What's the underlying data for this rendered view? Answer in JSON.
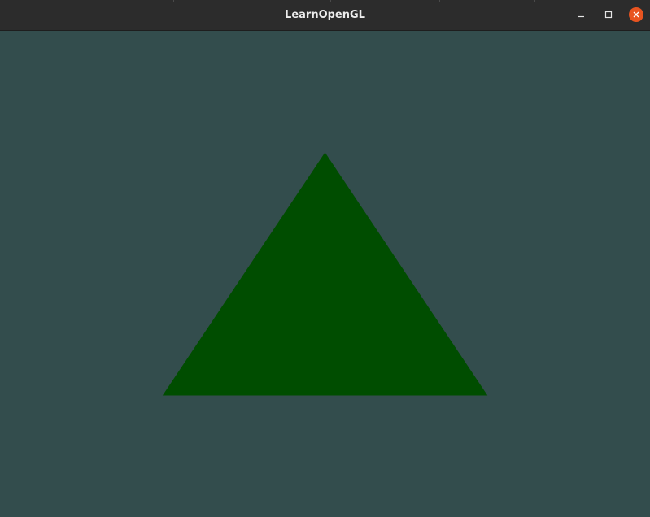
{
  "window": {
    "title": "LearnOpenGL",
    "controls": {
      "minimize_icon": "minimize-icon",
      "maximize_icon": "maximize-icon",
      "close_icon": "close-icon"
    }
  },
  "scene": {
    "clear_color": "#334d4d",
    "shape": "triangle",
    "shape_color": "#004d00",
    "vertices_ndc": [
      [
        -0.5,
        -0.5
      ],
      [
        0.5,
        -0.5
      ],
      [
        0.0,
        0.5
      ]
    ]
  },
  "colors": {
    "titlebar_bg": "#2c2c2c",
    "title_text": "#ececec",
    "close_button": "#e95420"
  }
}
